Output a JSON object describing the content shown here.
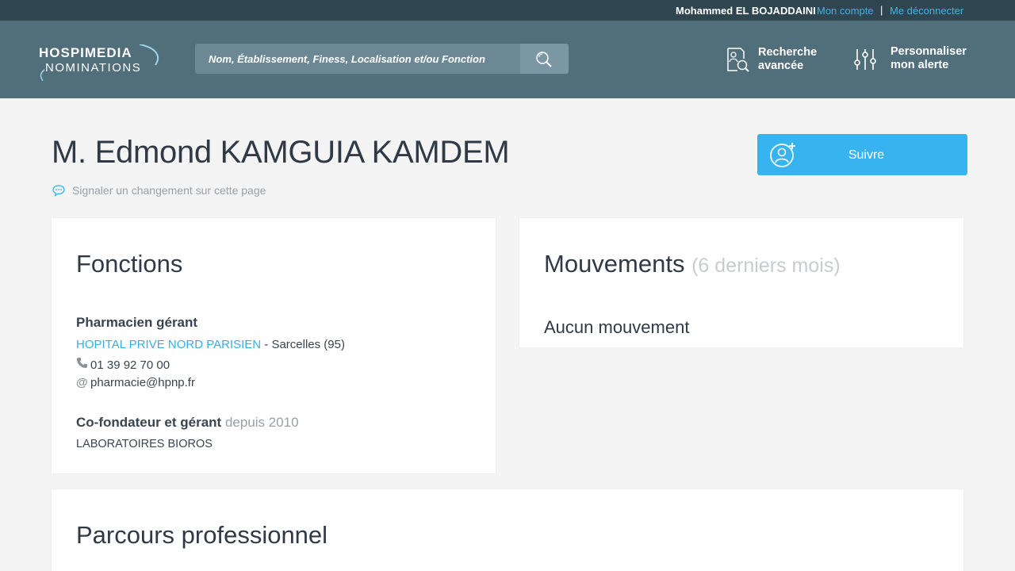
{
  "userbar": {
    "user_name": "Mohammed EL BOJADDAINI",
    "account_link": "Mon compte",
    "separator": "|",
    "logout_link": "Me déconnecter"
  },
  "header": {
    "logo_line1": "HOSPIMEDIA",
    "logo_line2": "NOMINATIONS",
    "search_placeholder": "Nom, Établissement, Finess, Localisation et/ou Fonction",
    "nav_advanced_search": "Recherche avancée",
    "nav_alert": "Personnaliser mon alerte"
  },
  "profile": {
    "name": "M. Edmond KAMGUIA KAMDEM",
    "report_text": "Signaler un changement sur cette page",
    "follow_label": "Suivre"
  },
  "fonctions": {
    "title": "Fonctions",
    "items": [
      {
        "role": "Pharmacien gérant",
        "organization": "HOPITAL PRIVE NORD PARISIEN",
        "location": " - Sarcelles (95)",
        "phone": "01 39 92 70 00",
        "email": "pharmacie@hpnp.fr"
      },
      {
        "role": "Co-fondateur et gérant",
        "since": " depuis 2010",
        "organization": "LABORATOIRES BIOROS"
      }
    ]
  },
  "mouvements": {
    "title": "Mouvements",
    "subtitle": "(6 derniers mois)",
    "empty_text": "Aucun mouvement"
  },
  "parcours": {
    "title": "Parcours professionnel"
  },
  "colors": {
    "accent": "#37b3ef",
    "header_bg": "#516e7b",
    "userbar_bg": "#2f4550"
  }
}
